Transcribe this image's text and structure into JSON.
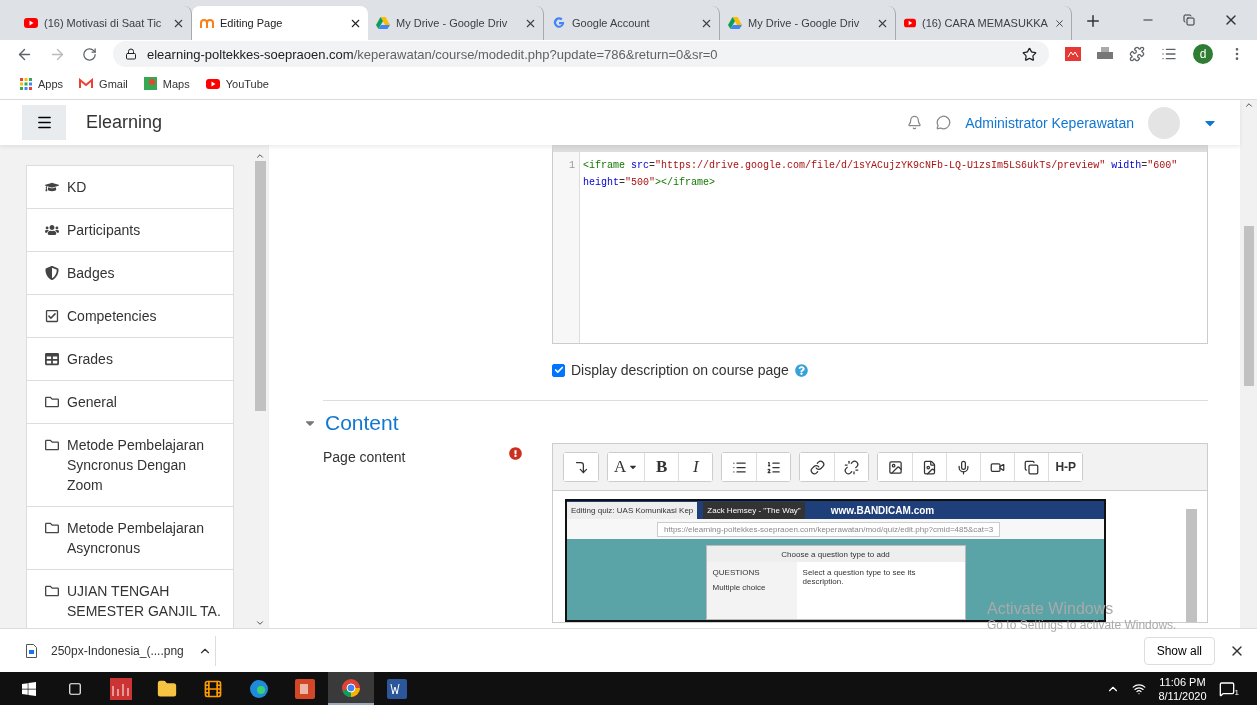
{
  "browser": {
    "tabs": [
      {
        "title": "(16) Motivasi di Saat Tic",
        "kind": "video",
        "selected": false
      },
      {
        "title": "Editing Page",
        "kind": "learning",
        "selected": true
      },
      {
        "title": "My Drive - Google Driv",
        "kind": "drive",
        "selected": false
      },
      {
        "title": "Google Account",
        "kind": "account",
        "selected": false
      },
      {
        "title": "My Drive - Google Driv",
        "kind": "drive",
        "selected": false
      },
      {
        "title": "(16) CARA MEMASUKKA",
        "kind": "video",
        "selected": false
      }
    ],
    "address": {
      "host": "elearning-poltekkes-soepraoen.com",
      "path": "/keperawatan/course/modedit.php?update=786&return=0&sr=0"
    },
    "profile_initial": "d",
    "bookmarks": [
      {
        "label": "Apps",
        "kind": "apps"
      },
      {
        "label": "Gmail",
        "kind": "mail"
      },
      {
        "label": "Maps",
        "kind": "maps"
      },
      {
        "label": "YouTube",
        "kind": "video"
      }
    ]
  },
  "header": {
    "site_name": "Elearning",
    "user_name": "Administrator Keperawatan"
  },
  "sidebar": {
    "items": [
      {
        "label": "KD",
        "kind": "cap"
      },
      {
        "label": "Participants",
        "kind": "users"
      },
      {
        "label": "Badges",
        "kind": "shield"
      },
      {
        "label": "Competencies",
        "kind": "check"
      },
      {
        "label": "Grades",
        "kind": "table"
      },
      {
        "label": "General",
        "kind": "folder"
      },
      {
        "label": "Metode Pembelajaran Syncronus Dengan Zoom",
        "kind": "folder"
      },
      {
        "label": "Metode Pembelajaran Asyncronus",
        "kind": "folder"
      },
      {
        "label": "UJIAN TENGAH SEMESTER GANJIL TA.",
        "kind": "folder"
      }
    ]
  },
  "form": {
    "code_editor": {
      "lines": [
        {
          "number": "1",
          "tokens": [
            {
              "kind": "tag",
              "text": "<iframe"
            },
            {
              "kind": "attr",
              "text": "src"
            },
            {
              "kind": "punct",
              "text": "="
            },
            {
              "kind": "value",
              "text": "\"https://drive.google.com/file/d/1sYACujzYK9cNFb-LQ-U1zsIm5LS6ukTs/preview\""
            },
            {
              "kind": "attr",
              "text": "width"
            },
            {
              "kind": "punct",
              "text": "="
            },
            {
              "kind": "value",
              "text": "\"600\""
            },
            {
              "kind": "attr",
              "text": "height"
            },
            {
              "kind": "punct",
              "text": "="
            },
            {
              "kind": "value",
              "text": "\"500\""
            },
            {
              "kind": "tag",
              "text": "></iframe>"
            }
          ]
        }
      ]
    },
    "display_checkbox": {
      "label": "Display description on course page",
      "checked": true
    },
    "section": {
      "title": "Content",
      "expanded": true
    },
    "field": {
      "label": "Page content",
      "required": true
    },
    "toolbar_groups": [
      [
        {
          "kind": "insert"
        }
      ],
      [
        {
          "kind": "font",
          "label": "A"
        },
        {
          "kind": "bold",
          "label": "B"
        },
        {
          "kind": "italic",
          "label": "I"
        }
      ],
      [
        {
          "kind": "bullets"
        },
        {
          "kind": "numbers"
        }
      ],
      [
        {
          "kind": "link"
        },
        {
          "kind": "unlink"
        }
      ],
      [
        {
          "kind": "image"
        },
        {
          "kind": "media"
        },
        {
          "kind": "microphone"
        },
        {
          "kind": "video"
        },
        {
          "kind": "copy"
        },
        {
          "kind": "h5p",
          "label": "H-P"
        }
      ]
    ],
    "embedded_screenshot": {
      "tabs": [
        "Editing quiz: UAS Komunikasi Kep",
        "Zack Hemsey - \"The Way\""
      ],
      "banner": "www.BANDICAM.com",
      "url": "https://elearning-poltekkes-soepraoen.com/keperawatan/mod/quiz/edit.php?cmid=485&cat=3",
      "dialog_title": "Choose a question type to add",
      "dialog_heading": "QUESTIONS",
      "option": "Multiple choice",
      "description": "Select a question type to see its description."
    }
  },
  "downloads": {
    "file": "250px-Indonesia_(....png",
    "show_all": "Show all"
  },
  "watermark": {
    "title": "Activate Windows",
    "subtitle": "Go to Settings to activate Windows."
  },
  "taskbar": {
    "apps": [
      {
        "kind": "start",
        "selected": false
      },
      {
        "kind": "taskview",
        "selected": false
      },
      {
        "kind": "stats",
        "selected": false
      },
      {
        "kind": "files",
        "selected": false
      },
      {
        "kind": "player",
        "selected": false
      },
      {
        "kind": "edge",
        "selected": false
      },
      {
        "kind": "slides",
        "selected": false
      },
      {
        "kind": "chrome",
        "selected": true
      },
      {
        "kind": "word",
        "selected": false
      }
    ],
    "time": "11:06 PM",
    "date": "8/11/2020",
    "notifications": "1"
  }
}
